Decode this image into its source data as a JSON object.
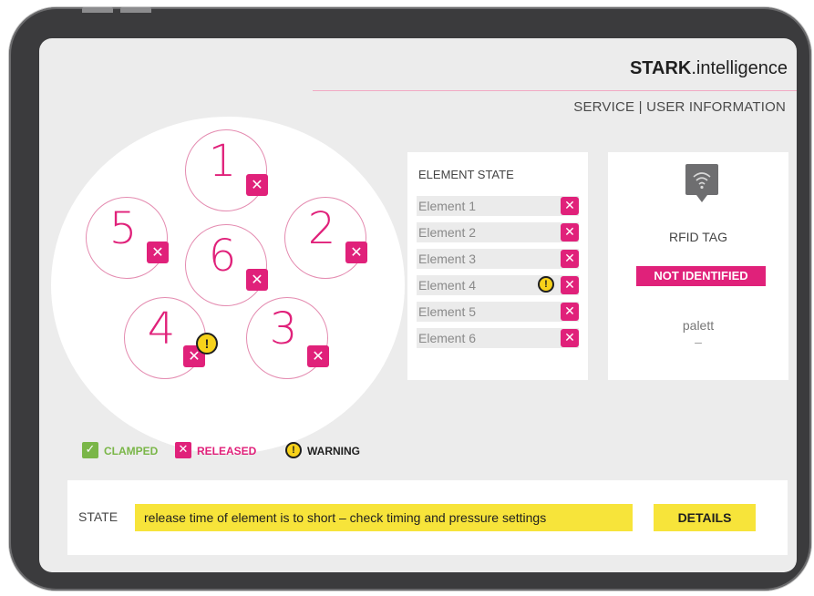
{
  "header": {
    "brand_bold": "STARK",
    "brand_rest": ".intelligence",
    "subtitle": "SERVICE | USER INFORMATION"
  },
  "elements": [
    {
      "number": "1",
      "state": "released",
      "warning": false
    },
    {
      "number": "2",
      "state": "released",
      "warning": false
    },
    {
      "number": "3",
      "state": "released",
      "warning": false
    },
    {
      "number": "4",
      "state": "released",
      "warning": true
    },
    {
      "number": "5",
      "state": "released",
      "warning": false
    },
    {
      "number": "6",
      "state": "released",
      "warning": false
    }
  ],
  "element_state": {
    "title": "ELEMENT STATE",
    "rows": [
      {
        "label": "Element 1",
        "state": "released",
        "warning": false
      },
      {
        "label": "Element 2",
        "state": "released",
        "warning": false
      },
      {
        "label": "Element 3",
        "state": "released",
        "warning": false
      },
      {
        "label": "Element 4",
        "state": "released",
        "warning": true
      },
      {
        "label": "Element 5",
        "state": "released",
        "warning": false
      },
      {
        "label": "Element 6",
        "state": "released",
        "warning": false
      }
    ]
  },
  "rfid": {
    "icon": "wifi-signal-icon",
    "title": "RFID TAG",
    "status": "NOT IDENTIFIED",
    "palett_label": "palett",
    "palett_value": "–"
  },
  "legend": {
    "clamped": "CLAMPED",
    "released": "RELEASED",
    "warning": "WARNING"
  },
  "state_bar": {
    "label": "STATE",
    "message": "release time of element is to short – check timing and pressure settings",
    "details_button": "DETAILS"
  },
  "colors": {
    "accent_magenta": "#e0217a",
    "clamped_green": "#7ab648",
    "warning_yellow": "#f7d21a",
    "highlight_yellow": "#f7e43a"
  }
}
